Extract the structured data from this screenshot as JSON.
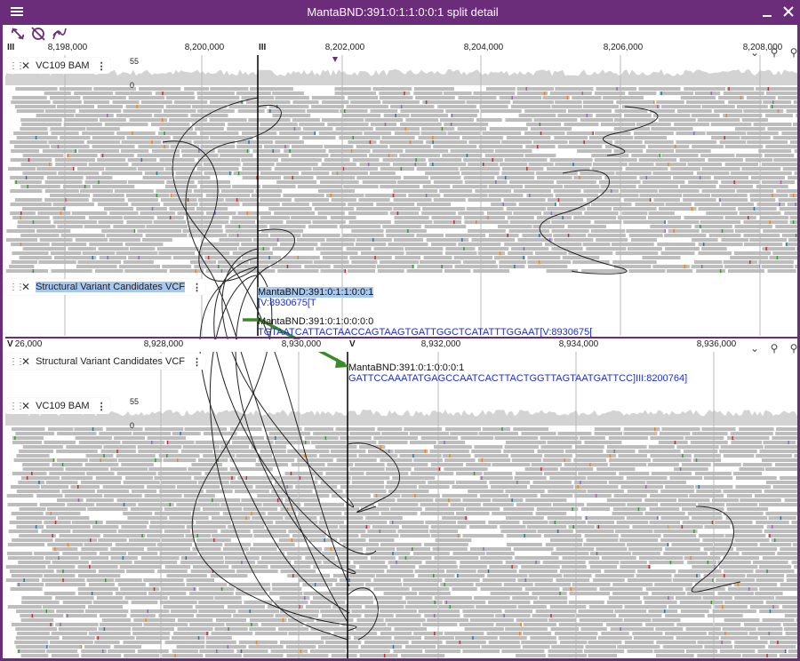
{
  "window": {
    "title": "MantaBND:391:0:1:1:0:0:1 split detail",
    "menu_icon": "hamburger-icon",
    "minimize_icon": "minimize-icon",
    "close_icon": "close-icon"
  },
  "toolbar": {
    "icons": [
      "unlink-icon",
      "sync-off-icon",
      "curves-icon"
    ]
  },
  "top_view": {
    "chromosome": "III",
    "ticks": [
      "8,198,000",
      "8,200,000",
      "8,202,000",
      "8,204,000",
      "8,206,000",
      "8,208,000"
    ],
    "marker_label": "III",
    "tracks": {
      "bam": {
        "label": "VC109 BAM",
        "scale_max": "55",
        "scale_min": "0"
      },
      "vcf": {
        "label": "Structural Variant Candidates VCF"
      }
    },
    "sv_labels": [
      {
        "name": "MantaBND:391:0:1:1:0:0:1",
        "seq": "[V:8930675[T"
      },
      {
        "name": "MantaBND:391:0:1:0:0:0:0",
        "seq": "TGTAATCATTACTAACCAGTAAGTGATTGGCTCATATTTGGAAT[V:8930675["
      }
    ]
  },
  "bottom_view": {
    "chromosome": "V",
    "ticks": [
      "8,928,000",
      "8,930,000",
      "8,932,000",
      "8,934,000",
      "8,936,000"
    ],
    "first_tick": "26,000",
    "marker_label": "V",
    "tracks": {
      "vcf": {
        "label": "Structural Variant Candidates VCF"
      },
      "bam": {
        "label": "VC109 BAM",
        "scale_max": "55",
        "scale_min": "0"
      }
    },
    "sv_labels": [
      {
        "name": "MantaBND:391:0:1:0:0:0:1",
        "seq": "GATTCCAAATATGAGCCAATCACTTACTGGTTAGTAATGATTCC]III:8200764]"
      }
    ]
  },
  "colors": {
    "accent": "#6b2c7a",
    "read_gray": "#bdbdbd",
    "coverage_gray": "#d3d3d3",
    "sv_text": "#1d2fd0",
    "arrow_green": "#3a8a2a"
  }
}
